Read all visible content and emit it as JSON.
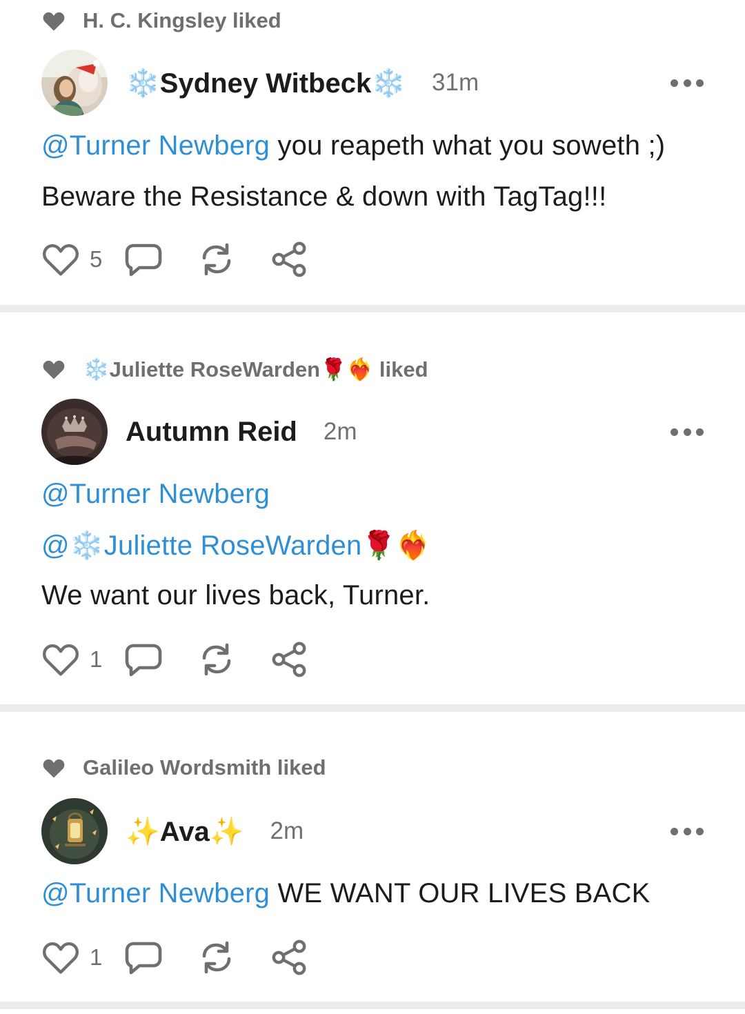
{
  "posts": [
    {
      "liked_by": "H. C. Kingsley liked",
      "author": "❄️Sydney Witbeck❄️",
      "time": "31m",
      "lines": [
        {
          "mention": "@Turner Newberg",
          "text": " you reapeth what you soweth ;)"
        },
        {
          "mention": "",
          "text": "Beware the Resistance & down with TagTag!!!"
        }
      ],
      "like_count": "5"
    },
    {
      "liked_by": "❄️Juliette RoseWarden🌹❤️‍🔥 liked",
      "author": "Autumn Reid",
      "time": "2m",
      "lines": [
        {
          "mention": "@Turner Newberg",
          "text": ""
        },
        {
          "mention": "@❄️Juliette RoseWarden🌹❤️‍🔥",
          "text": ""
        },
        {
          "mention": "",
          "text": "We want our lives back, Turner."
        }
      ],
      "like_count": "1"
    },
    {
      "liked_by": "Galileo Wordsmith liked",
      "author": "✨Ava✨",
      "time": "2m",
      "lines": [
        {
          "mention": "@Turner Newberg",
          "text": " WE WANT OUR LIVES BACK"
        }
      ],
      "like_count": "1"
    }
  ],
  "icons": {
    "liked_indicator": "heart-filled-icon",
    "like": "heart-outline-icon",
    "reply": "comment-bubble-icon",
    "repost": "repost-icon",
    "share": "share-icon",
    "more": "more-dots-icon"
  },
  "colors": {
    "mention": "#2e8fd6",
    "secondary_text": "#6f6f6f",
    "divider": "#ececec"
  }
}
